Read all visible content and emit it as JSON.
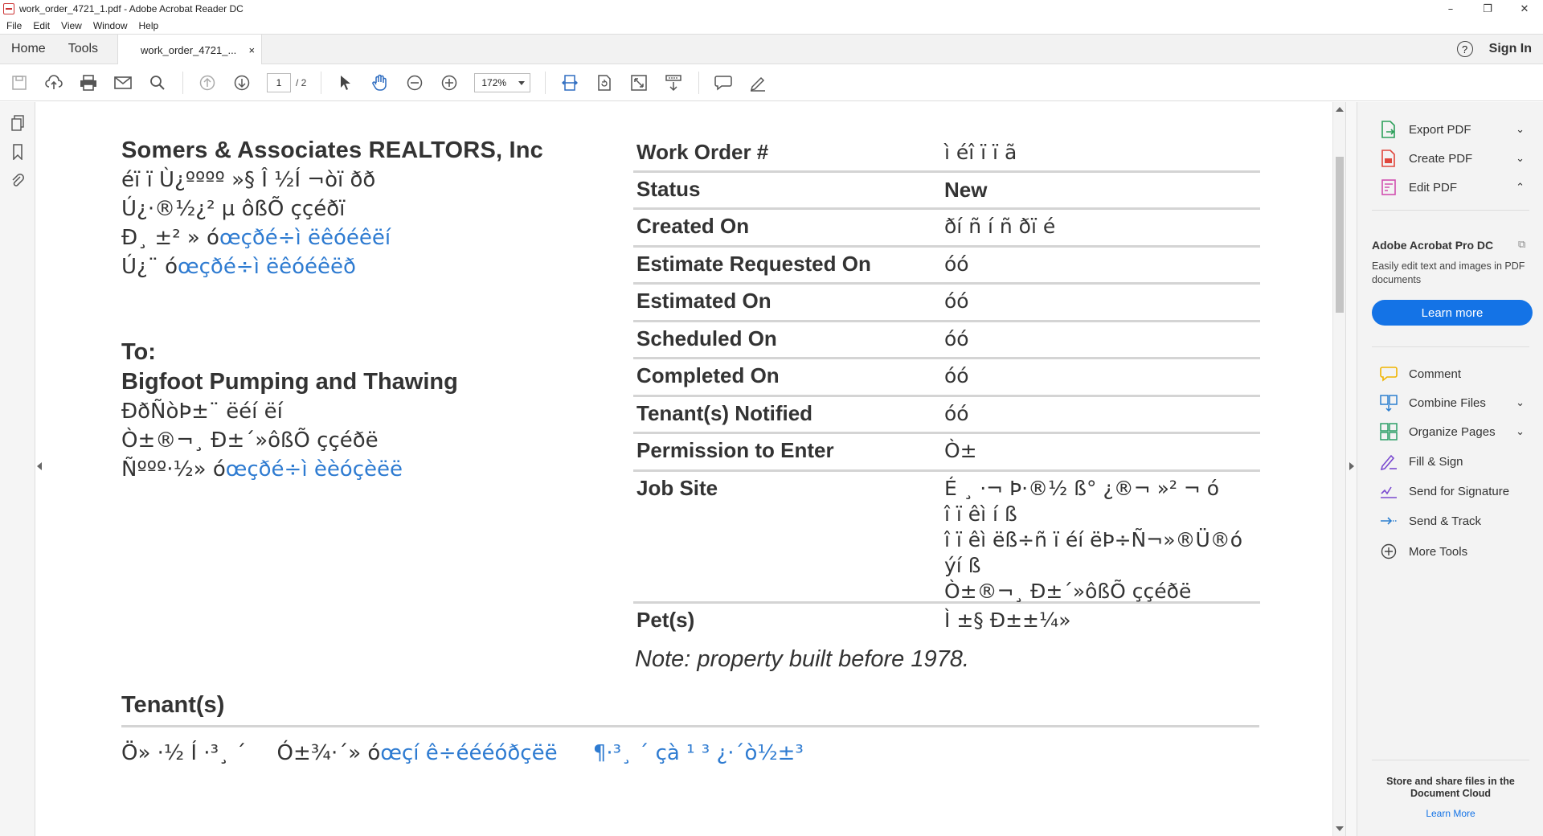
{
  "window": {
    "title": "work_order_4721_1.pdf - Adobe Acrobat Reader DC",
    "controls": [
      "–",
      "❐",
      "✕"
    ]
  },
  "menu": [
    "File",
    "Edit",
    "View",
    "Window",
    "Help"
  ],
  "tabs": {
    "home": "Home",
    "tools": "Tools",
    "document": "work_order_4721_...",
    "close": "×",
    "help": "?",
    "sign_in": "Sign In"
  },
  "toolbar": {
    "page_current": "1",
    "page_total": "/ 2",
    "zoom": "172%"
  },
  "document": {
    "company": "Somers & Associates REALTORS, Inc",
    "company_lines": [
      {
        "text": "éï ï  Ù¿ºººº »§ Î  ½Í  ¬òï ðð",
        "blue": ""
      },
      {
        "text": "Ú¿·®½¿² µ  ôßÕ ççéðï",
        "blue": ""
      },
      {
        "text": "Ð¸ ±² » ó",
        "blue": "œçðé÷ì ëêóéêëí"
      },
      {
        "text": "Ú¿¨  ó",
        "blue": "œçðé÷ì ëêóéêëð"
      }
    ],
    "to_label": "To:",
    "vendor": "Bigfoot Pumping and Thawing",
    "vendor_lines": [
      {
        "text": "ÐðÑòÞ±¨  ëéí ëí",
        "blue": ""
      },
      {
        "text": "Ò±®¬¸ Ð±´»ôßÕ ççéðë",
        "blue": ""
      },
      {
        "text": "Ñººº·½» ó",
        "blue": "œçðé÷ì èèóçèëë"
      }
    ],
    "work_order_rows": [
      {
        "label": "Work Order #",
        "value": "ì éî ï ï ã"
      },
      {
        "label": "Status",
        "value": "New"
      },
      {
        "label": "Created On",
        "value": "ðí ñ í ñ ðï é"
      },
      {
        "label": "Estimate Requested On",
        "value": "óó"
      },
      {
        "label": "Estimated On",
        "value": "óó"
      },
      {
        "label": "Scheduled On",
        "value": "óó"
      },
      {
        "label": "Completed On",
        "value": "óó"
      },
      {
        "label": "Tenant(s) Notified",
        "value": "óó"
      },
      {
        "label": "Permission to Enter",
        "value": "Ò±"
      },
      {
        "label": "Job Site",
        "value_lines": [
          "É ¸ ·¬ Þ·®½ ß° ¿®¬ »² ¬ ó",
          "î ï êì  í ß",
          "î ï êì ëß÷ñ ï éí ëÞ÷Ñ¬»®Ü®ó",
          "ýí ß",
          "Ò±®¬¸ Ð±´»ôßÕ ççéðë"
        ]
      },
      {
        "label": "Pet(s)",
        "value": "Ì ±§ Ð±±¼»"
      }
    ],
    "note": "Note: property built before 1978.",
    "tenants_heading": "Tenant(s)",
    "tenant_text": "Ö»   ·½ Í ·³¸   ´ ",
    "tenant_phone_prefix": "Ó±¾·´» ó",
    "tenant_phone": "œçí ê÷éééóðçëë",
    "tenant_email": "¶·³¸ ´ çà ¹ ³ ¿·´ò½±³"
  },
  "right_pane": {
    "tools": [
      {
        "label": "Export PDF",
        "chevron": "⌄",
        "color": "#2c9f5a"
      },
      {
        "label": "Create PDF",
        "chevron": "⌄",
        "color": "#e0473d"
      },
      {
        "label": "Edit PDF",
        "chevron": "⌃",
        "color": "#d14fb0"
      }
    ],
    "promo_title": "Adobe Acrobat Pro DC",
    "promo_desc": "Easily edit text and images in PDF documents",
    "promo_button": "Learn more",
    "more_tools": [
      {
        "label": "Comment",
        "chevron": "",
        "color": "#f0b400"
      },
      {
        "label": "Combine Files",
        "chevron": "⌄",
        "color": "#2d7fd0"
      },
      {
        "label": "Organize Pages",
        "chevron": "⌄",
        "color": "#2d9f68"
      },
      {
        "label": "Fill & Sign",
        "chevron": "",
        "color": "#7a4ad0"
      },
      {
        "label": "Send for Signature",
        "chevron": "",
        "color": "#7a4ad0"
      },
      {
        "label": "Send & Track",
        "chevron": "",
        "color": "#2d7fd0"
      },
      {
        "label": "More Tools",
        "chevron": "",
        "color": "#444444"
      }
    ],
    "store_text": "Store and share files in the Document Cloud",
    "store_link": "Learn More"
  }
}
